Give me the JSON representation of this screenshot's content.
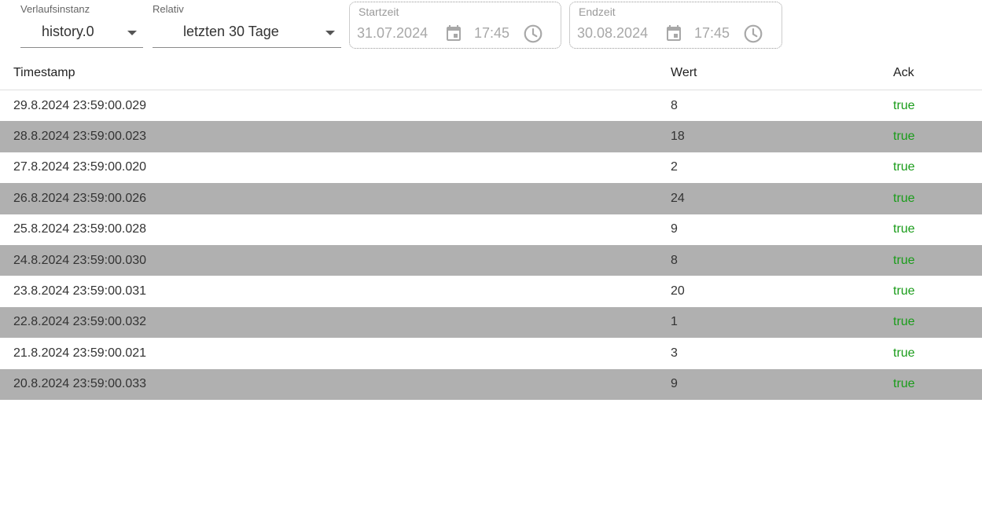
{
  "filters": {
    "instance": {
      "label": "Verlaufsinstanz",
      "value": "history.0"
    },
    "relative": {
      "label": "Relativ",
      "value": "letzten 30 Tage"
    },
    "start": {
      "label": "Startzeit",
      "date": "31.07.2024",
      "time": "17:45"
    },
    "end": {
      "label": "Endzeit",
      "date": "30.08.2024",
      "time": "17:45"
    }
  },
  "table": {
    "headers": {
      "timestamp": "Timestamp",
      "value": "Wert",
      "ack": "Ack"
    },
    "rows": [
      {
        "timestamp": "29.8.2024 23:59:00.029",
        "value": "8",
        "ack": "true"
      },
      {
        "timestamp": "28.8.2024 23:59:00.023",
        "value": "18",
        "ack": "true"
      },
      {
        "timestamp": "27.8.2024 23:59:00.020",
        "value": "2",
        "ack": "true"
      },
      {
        "timestamp": "26.8.2024 23:59:00.026",
        "value": "24",
        "ack": "true"
      },
      {
        "timestamp": "25.8.2024 23:59:00.028",
        "value": "9",
        "ack": "true"
      },
      {
        "timestamp": "24.8.2024 23:59:00.030",
        "value": "8",
        "ack": "true"
      },
      {
        "timestamp": "23.8.2024 23:59:00.031",
        "value": "20",
        "ack": "true"
      },
      {
        "timestamp": "22.8.2024 23:59:00.032",
        "value": "1",
        "ack": "true"
      },
      {
        "timestamp": "21.8.2024 23:59:00.021",
        "value": "3",
        "ack": "true"
      },
      {
        "timestamp": "20.8.2024 23:59:00.033",
        "value": "9",
        "ack": "true"
      }
    ]
  },
  "colors": {
    "ack_true": "#1a9c1a",
    "row_stripe": "#b0b0b0",
    "disabled_text": "#a8a8a8"
  },
  "icons": {
    "dropdown": "chevron-down-icon",
    "date": "calendar-icon",
    "time": "clock-icon"
  }
}
